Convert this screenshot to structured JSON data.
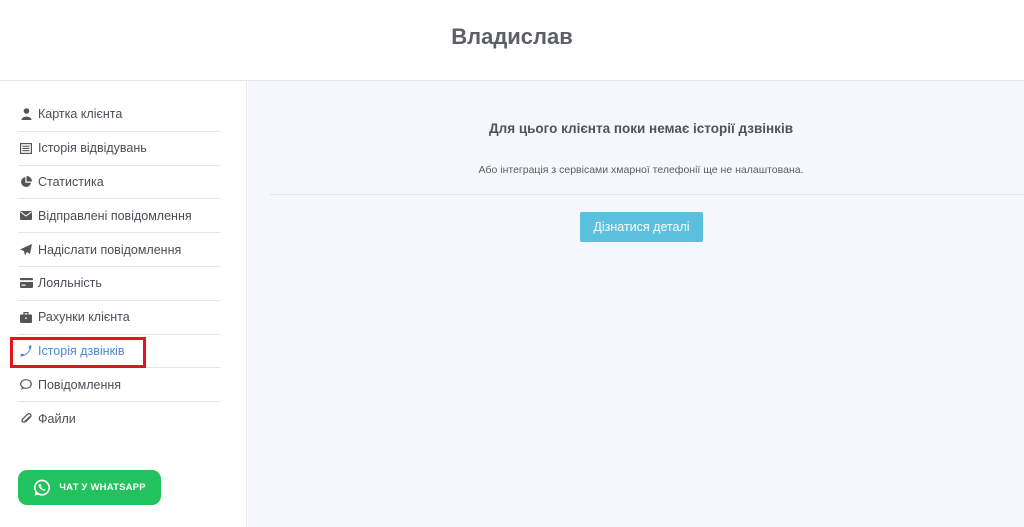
{
  "header": {
    "title": "Владислав"
  },
  "sidebar": {
    "items": [
      {
        "label": "Картка клієнта",
        "icon": "user-icon"
      },
      {
        "label": "Історія відвідувань",
        "icon": "list-icon"
      },
      {
        "label": "Статистика",
        "icon": "pie-chart-icon"
      },
      {
        "label": "Відправлені повідомлення",
        "icon": "envelope-icon"
      },
      {
        "label": "Надіслати повідомлення",
        "icon": "paper-plane-icon"
      },
      {
        "label": "Лояльність",
        "icon": "credit-card-icon"
      },
      {
        "label": "Рахунки клієнта",
        "icon": "briefcase-icon"
      },
      {
        "label": "Історія дзвінків",
        "icon": "phone-icon",
        "active": true
      },
      {
        "label": "Повідомлення",
        "icon": "chat-bubble-icon"
      },
      {
        "label": "Файли",
        "icon": "paperclip-icon"
      }
    ],
    "whatsapp_label": "ЧАТ У WHATSAPP"
  },
  "main": {
    "empty_title": "Для цього клієнта поки немає історії дзвінків",
    "empty_subtitle": "Або інтеграція з сервісами хмарної телефонії ще не налаштована.",
    "details_button": "Дізнатися деталі"
  },
  "colors": {
    "accent": "#4a88d6",
    "whatsapp": "#22c35e",
    "info_button": "#5bc0de",
    "highlight": "#e3141e",
    "main_bg": "#f5f7fc"
  }
}
